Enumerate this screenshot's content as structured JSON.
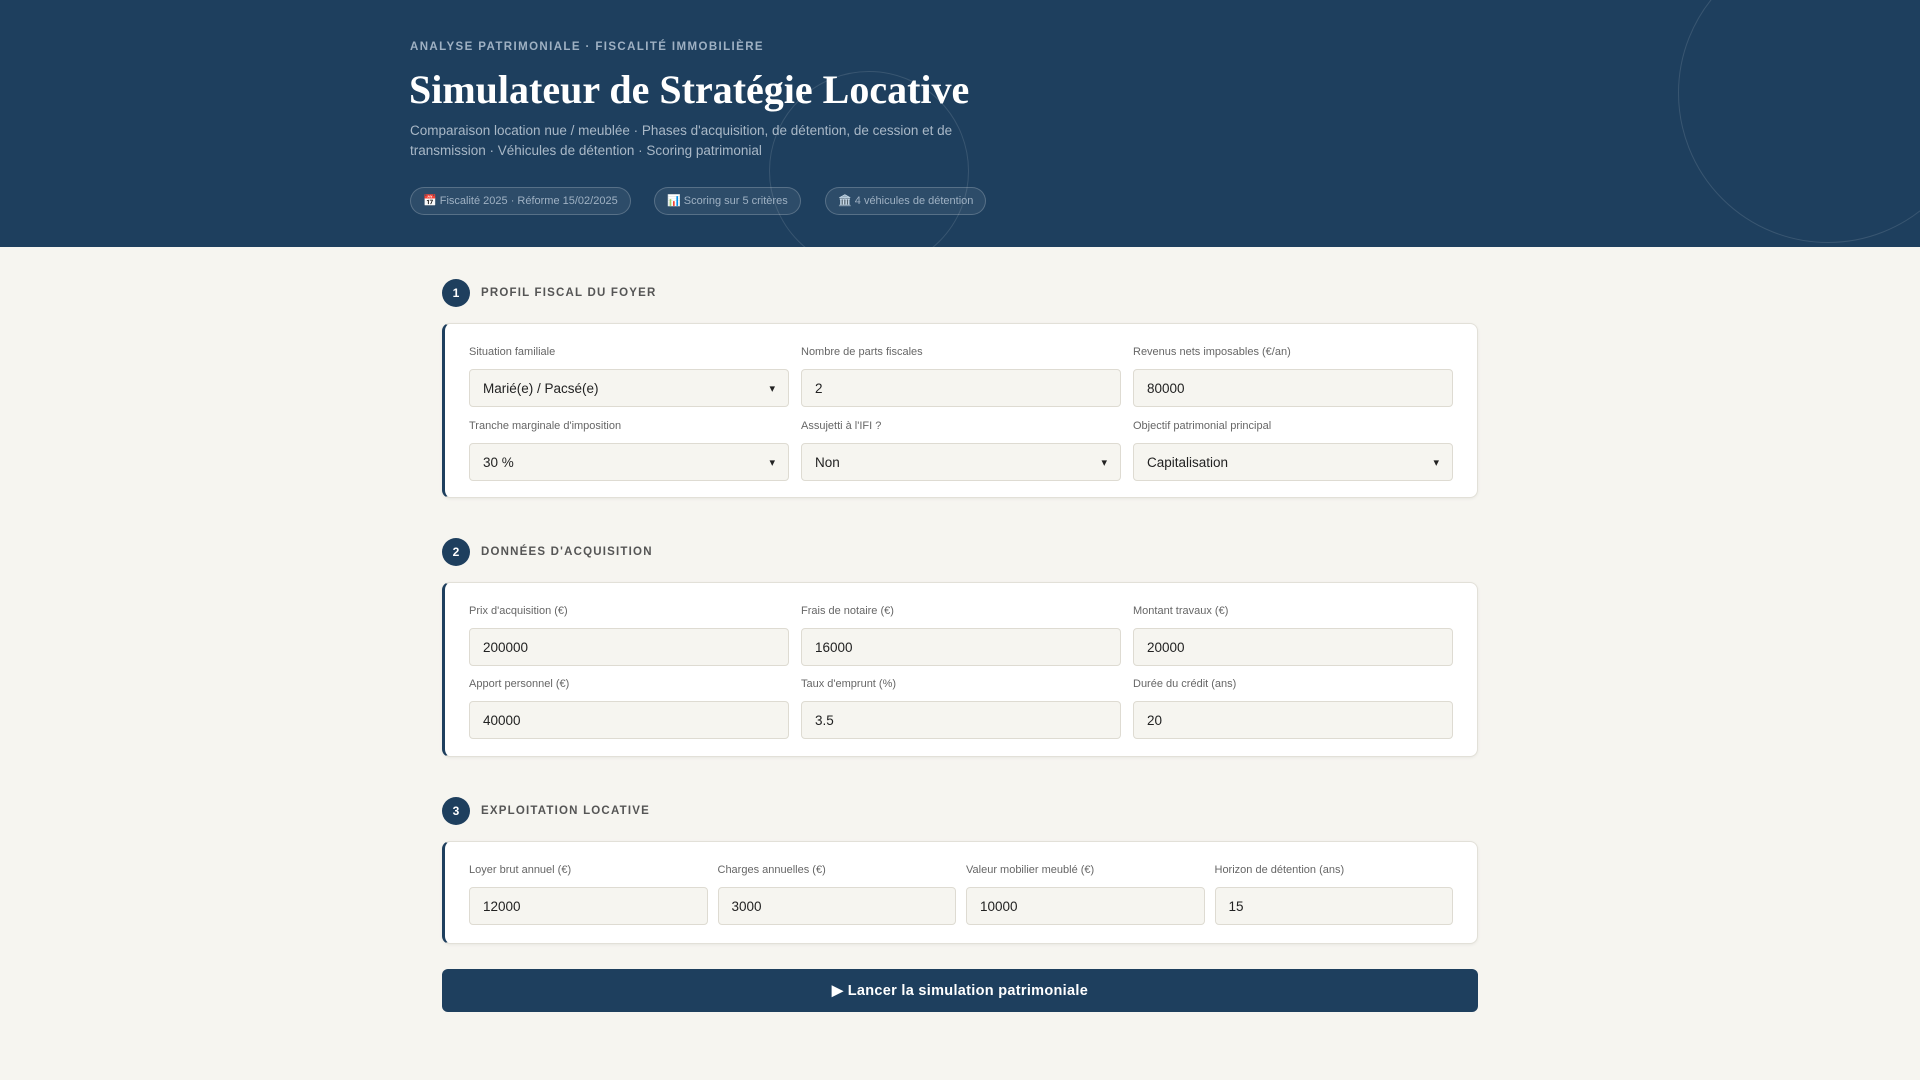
{
  "header": {
    "eyebrow": "ANALYSE PATRIMONIALE · FISCALITÉ IMMOBILIÈRE",
    "title": "Simulateur de Stratégie Locative",
    "subtitle": "Comparaison location nue / meublée · Phases d'acquisition, de détention, de cession et de transmission · Véhicules de détention · Scoring patrimonial",
    "pills": [
      {
        "icon": "📅",
        "label": "Fiscalité 2025 · Réforme 15/02/2025"
      },
      {
        "icon": "📊",
        "label": "Scoring sur 5 critères"
      },
      {
        "icon": "🏛️",
        "label": "4 véhicules de détention"
      }
    ]
  },
  "sections": [
    {
      "number": "1",
      "title": "PROFIL FISCAL DU FOYER",
      "fields": [
        {
          "label": "Situation familiale",
          "value": "Marié(e) / Pacsé(e)",
          "type": "select"
        },
        {
          "label": "Nombre de parts fiscales",
          "value": "2",
          "type": "input"
        },
        {
          "label": "Revenus nets imposables (€/an)",
          "value": "80000",
          "type": "input"
        },
        {
          "label": "Tranche marginale d'imposition",
          "value": "30 %",
          "type": "select"
        },
        {
          "label": "Assujetti à l'IFI ?",
          "value": "Non",
          "type": "select"
        },
        {
          "label": "Objectif patrimonial principal",
          "value": "Capitalisation",
          "type": "select"
        }
      ]
    },
    {
      "number": "2",
      "title": "DONNÉES D'ACQUISITION",
      "fields": [
        {
          "label": "Prix d'acquisition (€)",
          "value": "200000"
        },
        {
          "label": "Frais de notaire (€)",
          "value": "16000"
        },
        {
          "label": "Montant travaux (€)",
          "value": "20000"
        },
        {
          "label": "Apport personnel (€)",
          "value": "40000"
        },
        {
          "label": "Taux d'emprunt (%)",
          "value": "3.5"
        },
        {
          "label": "Durée du crédit (ans)",
          "value": "20"
        }
      ]
    },
    {
      "number": "3",
      "title": "EXPLOITATION LOCATIVE",
      "fields": [
        {
          "label": "Loyer brut annuel (€)",
          "value": "12000"
        },
        {
          "label": "Charges annuelles (€)",
          "value": "3000"
        },
        {
          "label": "Valeur mobilier meublé (€)",
          "value": "10000"
        },
        {
          "label": "Horizon de détention (ans)",
          "value": "15"
        }
      ]
    }
  ],
  "submit": {
    "icon": "▶",
    "label": "Lancer la simulation patrimoniale"
  }
}
